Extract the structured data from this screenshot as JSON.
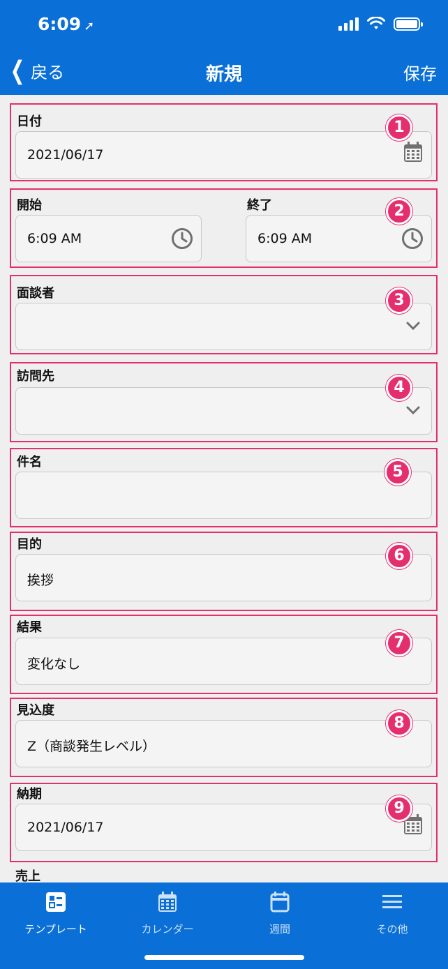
{
  "status": {
    "time": "6:09"
  },
  "nav": {
    "back_label": "戻る",
    "title": "新規",
    "save_label": "保存"
  },
  "fields": {
    "date": {
      "label": "日付",
      "value": "2021/06/17",
      "marker": "1"
    },
    "time": {
      "start_label": "開始",
      "start_value": "6:09 AM",
      "end_label": "終了",
      "end_value": "6:09 AM",
      "marker": "2"
    },
    "interviewer": {
      "label": "面談者",
      "value": "",
      "marker": "3"
    },
    "visit": {
      "label": "訪問先",
      "value": "",
      "marker": "4"
    },
    "subject": {
      "label": "件名",
      "value": "",
      "marker": "5"
    },
    "purpose": {
      "label": "目的",
      "value": "挨拶",
      "marker": "6"
    },
    "result": {
      "label": "結果",
      "value": "変化なし",
      "marker": "7"
    },
    "prospect": {
      "label": "見込度",
      "value": "Z（商談発生レベル）",
      "marker": "8"
    },
    "delivery": {
      "label": "納期",
      "value": "2021/06/17",
      "marker": "9"
    },
    "sales": {
      "label": "売上"
    }
  },
  "tabs": [
    {
      "label": "テンプレート",
      "icon": "template-icon"
    },
    {
      "label": "カレンダー",
      "icon": "calendar-icon"
    },
    {
      "label": "週間",
      "icon": "week-icon"
    },
    {
      "label": "その他",
      "icon": "menu-icon"
    }
  ],
  "colors": {
    "header": "#0a6fd6",
    "annotation": "#e52e6e"
  }
}
